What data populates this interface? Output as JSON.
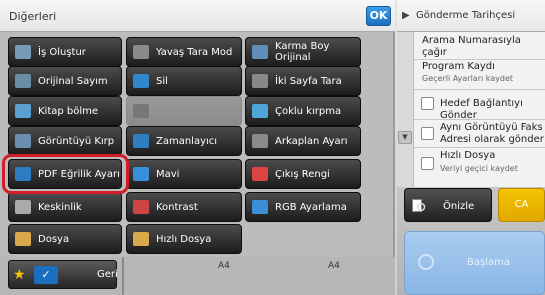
{
  "left_panel": {
    "title": "Diğerleri",
    "ok_label": "OK",
    "buttons": [
      {
        "label": "İş Oluştur",
        "icon": "job-build-icon"
      },
      {
        "label": "Yavaş Tara Mod",
        "icon": "slow-scan-icon"
      },
      {
        "label": "Karma Boy Orijinal",
        "icon": "mixed-size-icon"
      },
      {
        "label": "Orijinal Sayım",
        "icon": "original-count-icon"
      },
      {
        "label": "Sil",
        "icon": "erase-icon"
      },
      {
        "label": "İki Sayfa Tara",
        "icon": "two-page-scan-icon"
      },
      {
        "label": "Kitap bölme",
        "icon": "book-divide-icon"
      },
      {
        "label": "",
        "icon": "blank-icon"
      },
      {
        "label": "Çoklu kırpma",
        "icon": "multi-crop-icon"
      },
      {
        "label": "Görüntüyü Kırp",
        "icon": "image-crop-icon"
      },
      {
        "label": "Zamanlayıcı",
        "icon": "timer-icon"
      },
      {
        "label": "Arkaplan Ayarı",
        "icon": "background-icon"
      },
      {
        "label": "PDF Eğrilik Ayarı",
        "icon": "pdf-skew-icon"
      },
      {
        "label": "Mavi",
        "icon": "blue-icon"
      },
      {
        "label": "Çıkış Rengi",
        "icon": "output-color-icon"
      },
      {
        "label": "Keskinlik",
        "icon": "sharpness-icon"
      },
      {
        "label": "Kontrast",
        "icon": "contrast-icon"
      },
      {
        "label": "RGB Ayarlama",
        "icon": "rgb-adjust-icon"
      },
      {
        "label": "Dosya",
        "icon": "file-icon"
      },
      {
        "label": "Hızlı Dosya",
        "icon": "quick-file-icon"
      }
    ],
    "bottom": {
      "back_label": "Geri",
      "paper_left": "A4",
      "paper_right": "A4"
    }
  },
  "right_panel": {
    "history_label": "Gönderme Tarihçesi",
    "items": {
      "call_search": "Arama Numarasıyla çağır",
      "program_call": "Program Kaydı",
      "program_call_sub": "Geçerli Ayarları kaydet",
      "link_dest": "Hedef Bağlantıyı Gönder",
      "same_image_fax": "Aynı Görüntüyü Faks Adresi olarak gönder",
      "quick_file": "Hızlı Dosya",
      "quick_file_sub": "Veriyi geçici kaydet"
    },
    "preview_label": "Önizle",
    "ca_label": "CA",
    "start_label": "Başlama"
  },
  "colors": {
    "accent_blue": "#1a6fbf",
    "ca_yellow": "#f0b800",
    "highlight_red": "#d21c2a"
  }
}
